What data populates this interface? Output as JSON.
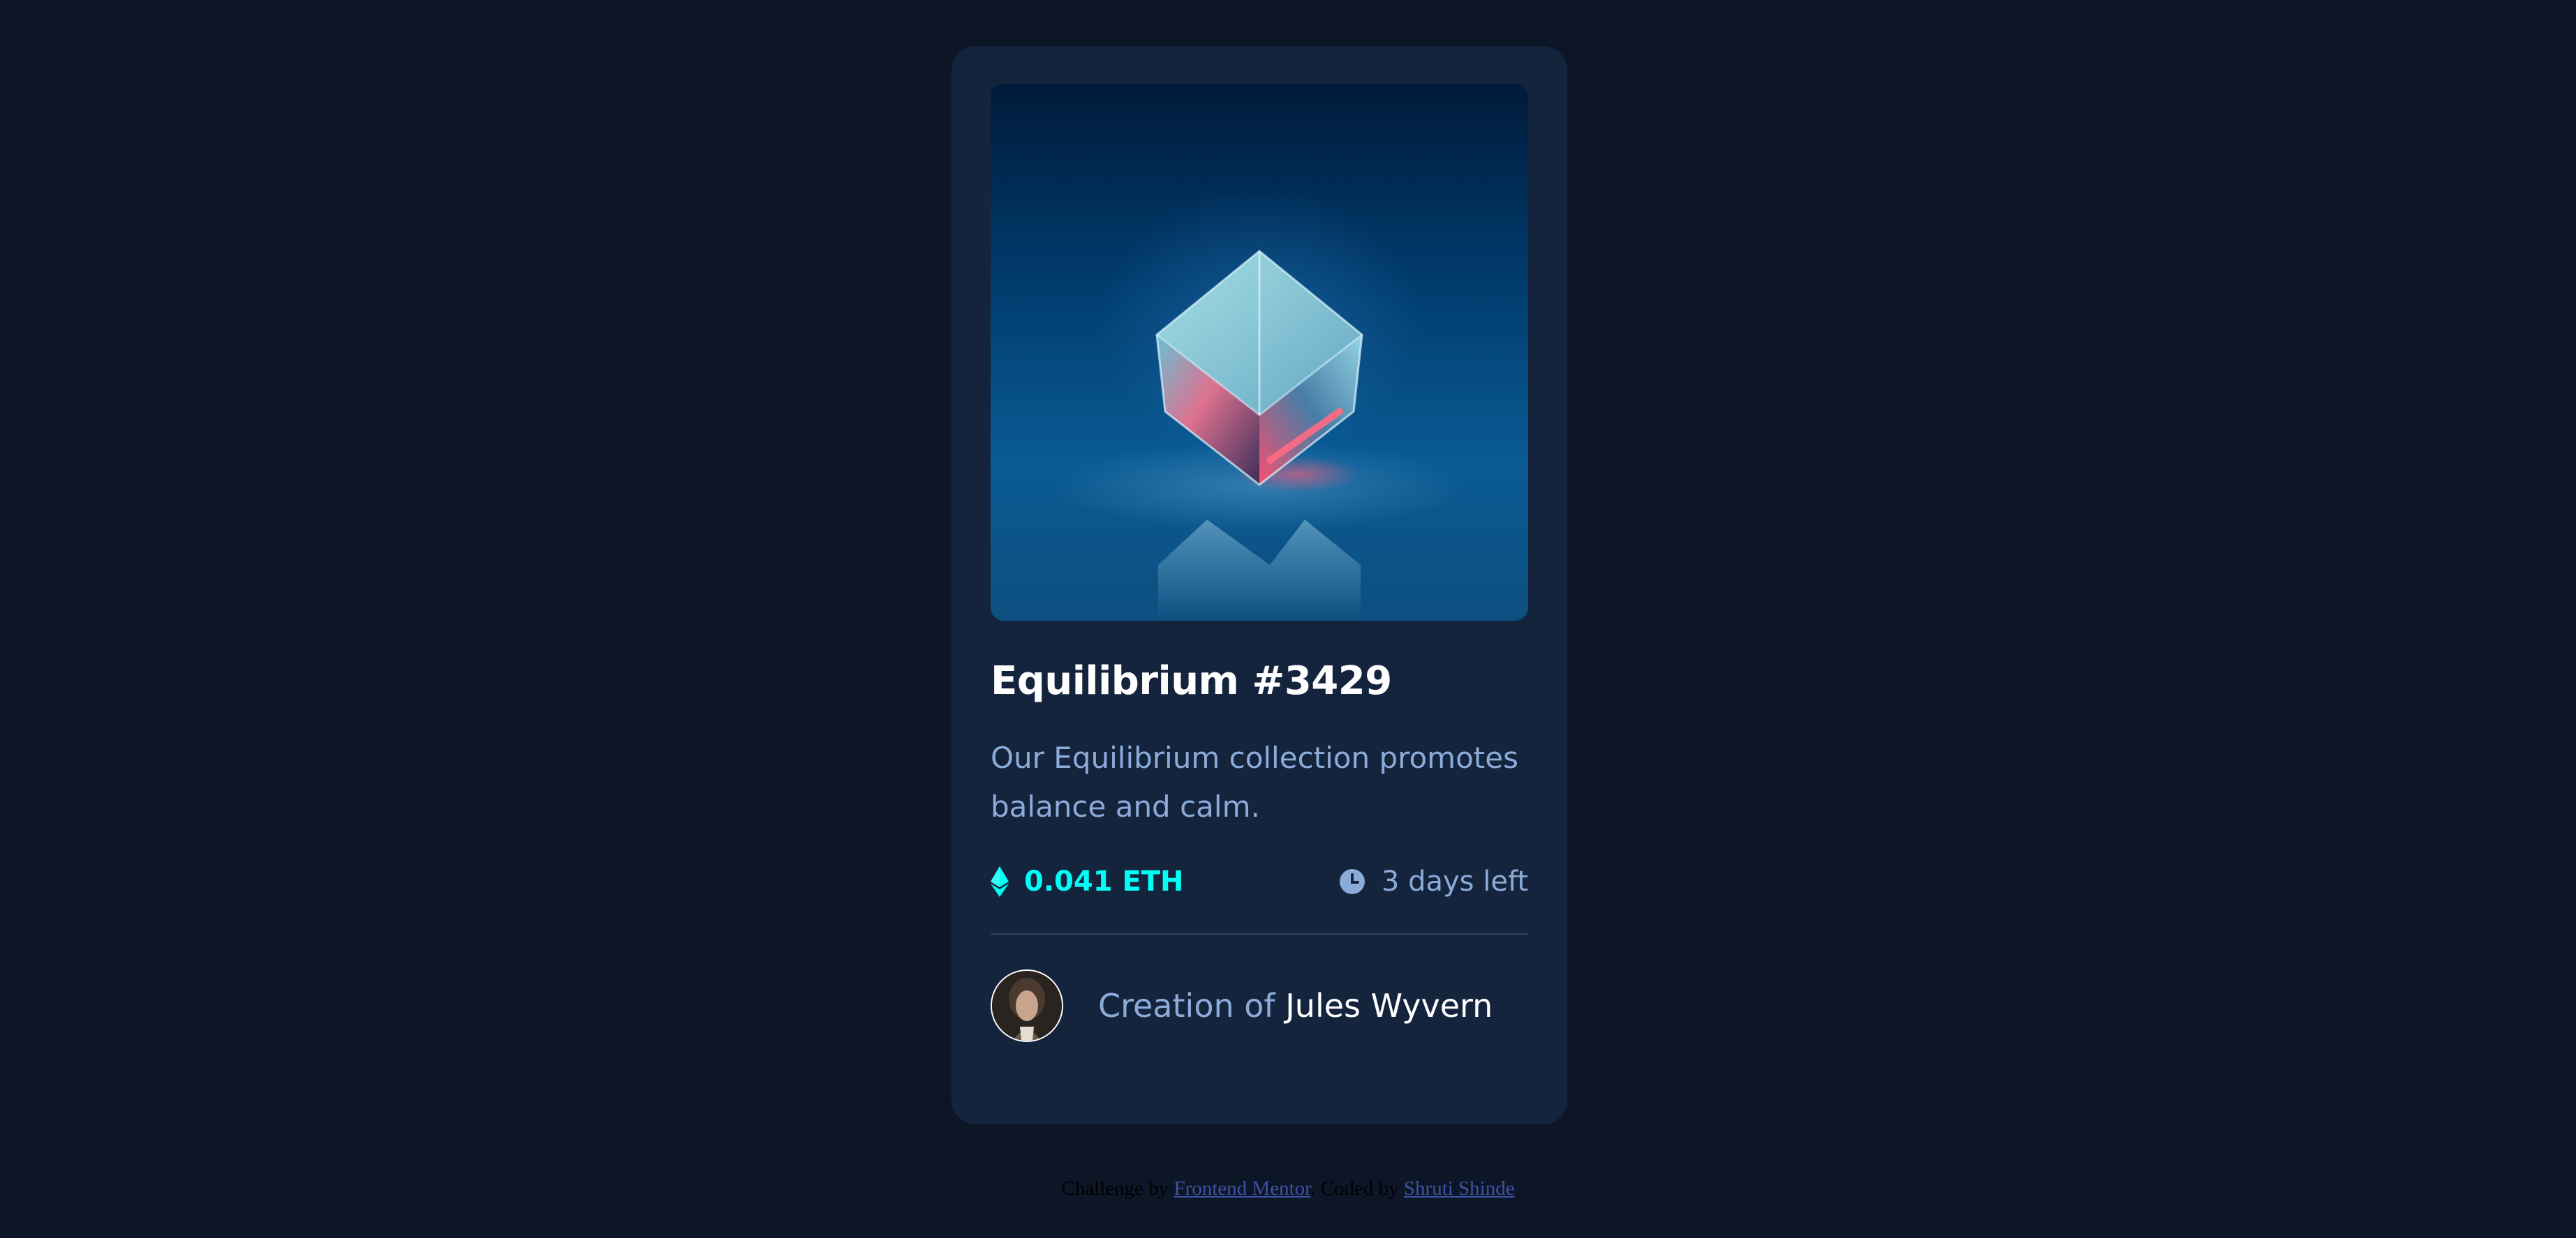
{
  "card": {
    "title": "Equilibrium #3429",
    "description": "Our Equilibrium collection promotes balance and calm.",
    "price": "0.041 ETH",
    "time_left": "3 days left",
    "creator_prefix": "Creation of",
    "creator_name": "Jules Wyvern",
    "image_icon": "crystal-cube-image",
    "price_icon": "ethereum-icon",
    "time_icon": "clock-icon",
    "avatar_icon": "avatar-portrait"
  },
  "footer": {
    "challenge_prefix": "Challenge by",
    "challenge_link": "Frontend Mentor",
    "coded_prefix": ". Coded by",
    "coded_link": "Shruti Shinde"
  },
  "colors": {
    "page_background": "#0d1627",
    "card_background": "#15243d",
    "accent_cyan": "#00fff7",
    "soft_blue": "#8bacd9",
    "white": "#ffffff",
    "divider": "#2e405a",
    "link": "#3e52a3"
  }
}
